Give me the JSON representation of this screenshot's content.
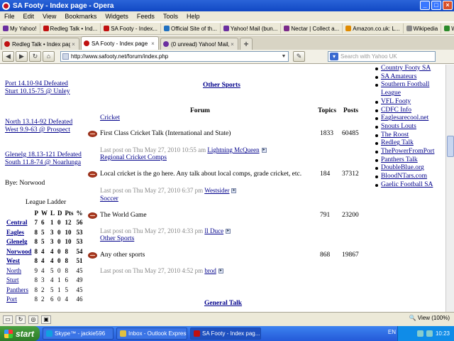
{
  "window": {
    "title": "SA Footy - Index page - Opera"
  },
  "menu": [
    "File",
    "Edit",
    "View",
    "Bookmarks",
    "Widgets",
    "Feeds",
    "Tools",
    "Help"
  ],
  "bookmarks": [
    {
      "label": "My Yahoo!",
      "color": "#6b2fa0"
    },
    {
      "label": "Redleg Talk • Ind...",
      "color": "#c01010"
    },
    {
      "label": "SA Footy - Index...",
      "color": "#c01010"
    },
    {
      "label": "Official Site of th...",
      "color": "#2070c0"
    },
    {
      "label": "Yahoo! Mail (bun...",
      "color": "#6b2fa0"
    },
    {
      "label": "Nectar | Collect a...",
      "color": "#7a2a8a"
    },
    {
      "label": "Amazon.co.uk: L...",
      "color": "#e08a00"
    },
    {
      "label": "Wikipedia",
      "color": "#888888"
    },
    {
      "label": "Windows Live Ho...",
      "color": "#2a8a2a"
    }
  ],
  "tabs": [
    {
      "label": "Redleg Talk • Index page",
      "color": "#c01010",
      "active": false
    },
    {
      "label": "SA Footy - Index page",
      "color": "#c01010",
      "active": true
    },
    {
      "label": "(0 unread) Yahoo! Mail, ...",
      "color": "#6b2fa0",
      "active": false
    }
  ],
  "address": {
    "url": "http://www.safooty.net/forum/index.php",
    "search_placeholder": "Search with Yahoo UK"
  },
  "left": {
    "scores": [
      [
        "Port 14.10-94 Defeated",
        "Sturt 10.15-75 @ Unley"
      ],
      [
        "North 13.14-92 Defeated",
        "West 9.9-63 @ Prospect"
      ],
      [
        "Glenelg 18.13-121 Defeated",
        "South 11.8-74 @ Noarlunga"
      ]
    ],
    "bye": "Bye: Norwood",
    "ladder_title": "League Ladder",
    "ladder_headers": [
      "",
      "P",
      "W",
      "L",
      "D",
      "Pts",
      "%"
    ],
    "ladder": [
      {
        "team": "Central",
        "p": "7",
        "w": "6",
        "l": "1",
        "d": "0",
        "pts": "12",
        "pct": "56",
        "bold": true
      },
      {
        "team": "Eagles",
        "p": "8",
        "w": "5",
        "l": "3",
        "d": "0",
        "pts": "10",
        "pct": "53",
        "bold": true
      },
      {
        "team": "Glenelg",
        "p": "8",
        "w": "5",
        "l": "3",
        "d": "0",
        "pts": "10",
        "pct": "53",
        "bold": true
      },
      {
        "team": "Norwood",
        "p": "8",
        "w": "4",
        "l": "4",
        "d": "0",
        "pts": "8",
        "pct": "54",
        "bold": true
      },
      {
        "team": "West",
        "p": "8",
        "w": "4",
        "l": "4",
        "d": "0",
        "pts": "8",
        "pct": "51",
        "bold": true
      },
      {
        "team": "North",
        "p": "9",
        "w": "4",
        "l": "5",
        "d": "0",
        "pts": "8",
        "pct": "45",
        "bold": false
      },
      {
        "team": "Sturt",
        "p": "8",
        "w": "3",
        "l": "4",
        "d": "1",
        "pts": "6",
        "pct": "49",
        "bold": false
      },
      {
        "team": "Panthers",
        "p": "8",
        "w": "2",
        "l": "5",
        "d": "1",
        "pts": "5",
        "pct": "45",
        "bold": false
      },
      {
        "team": "Port",
        "p": "8",
        "w": "2",
        "l": "6",
        "d": "0",
        "pts": "4",
        "pct": "46",
        "bold": false
      }
    ]
  },
  "main": {
    "other_sports": "Other Sports",
    "headers": {
      "forum": "Forum",
      "topics": "Topics",
      "posts": "Posts"
    },
    "categories": [
      "Cricket",
      "Regional Cricket Comps",
      "Soccer",
      "Other Sports"
    ],
    "forums": [
      {
        "name": "First Class Cricket Talk (International and State)",
        "topics": "1833",
        "posts": "60485",
        "lastpost": "Last post on Thu May 27, 2010 10:55 am",
        "author": "Lightning McQueen"
      },
      {
        "name": "Local cricket is the go here. Any talk about local comps, grade cricket, etc.",
        "topics": "184",
        "posts": "37312",
        "lastpost": "Last post on Thu May 27, 2010 6:37 pm",
        "author": "Westsider"
      },
      {
        "name": "The World Game",
        "topics": "791",
        "posts": "23200",
        "lastpost": "Last post on Thu May 27, 2010 4:33 pm",
        "author": "Il Duce"
      },
      {
        "name": "Any other sports",
        "topics": "868",
        "posts": "19867",
        "lastpost": "Last post on Thu May 27, 2010 4:52 pm",
        "author": "brod"
      }
    ],
    "general_talk": "General Talk"
  },
  "right_links": [
    "Country Footy SA",
    "SA Amateurs",
    "Southern Football League",
    "VFL Footy",
    "CDFC Info",
    "Eaglesarecool.net",
    "Snouts Louts",
    "The Roost",
    "Redleg Talk",
    "ThePowerFromPort",
    "Panthers Talk",
    "DoubleBlue.org",
    "BloodNTars.com",
    "Gaelic Football SA"
  ],
  "status": {
    "zoom": "View (100%)"
  },
  "taskbar": {
    "start": "start",
    "tasks": [
      {
        "label": "Skype™ - jackie596",
        "color": "#10a0e0"
      },
      {
        "label": "Inbox - Outlook Express",
        "color": "#e0c040"
      },
      {
        "label": "SA Footy - Index pag...",
        "color": "#c01010",
        "active": true
      }
    ],
    "lang": "EN",
    "clock": "10:23"
  }
}
